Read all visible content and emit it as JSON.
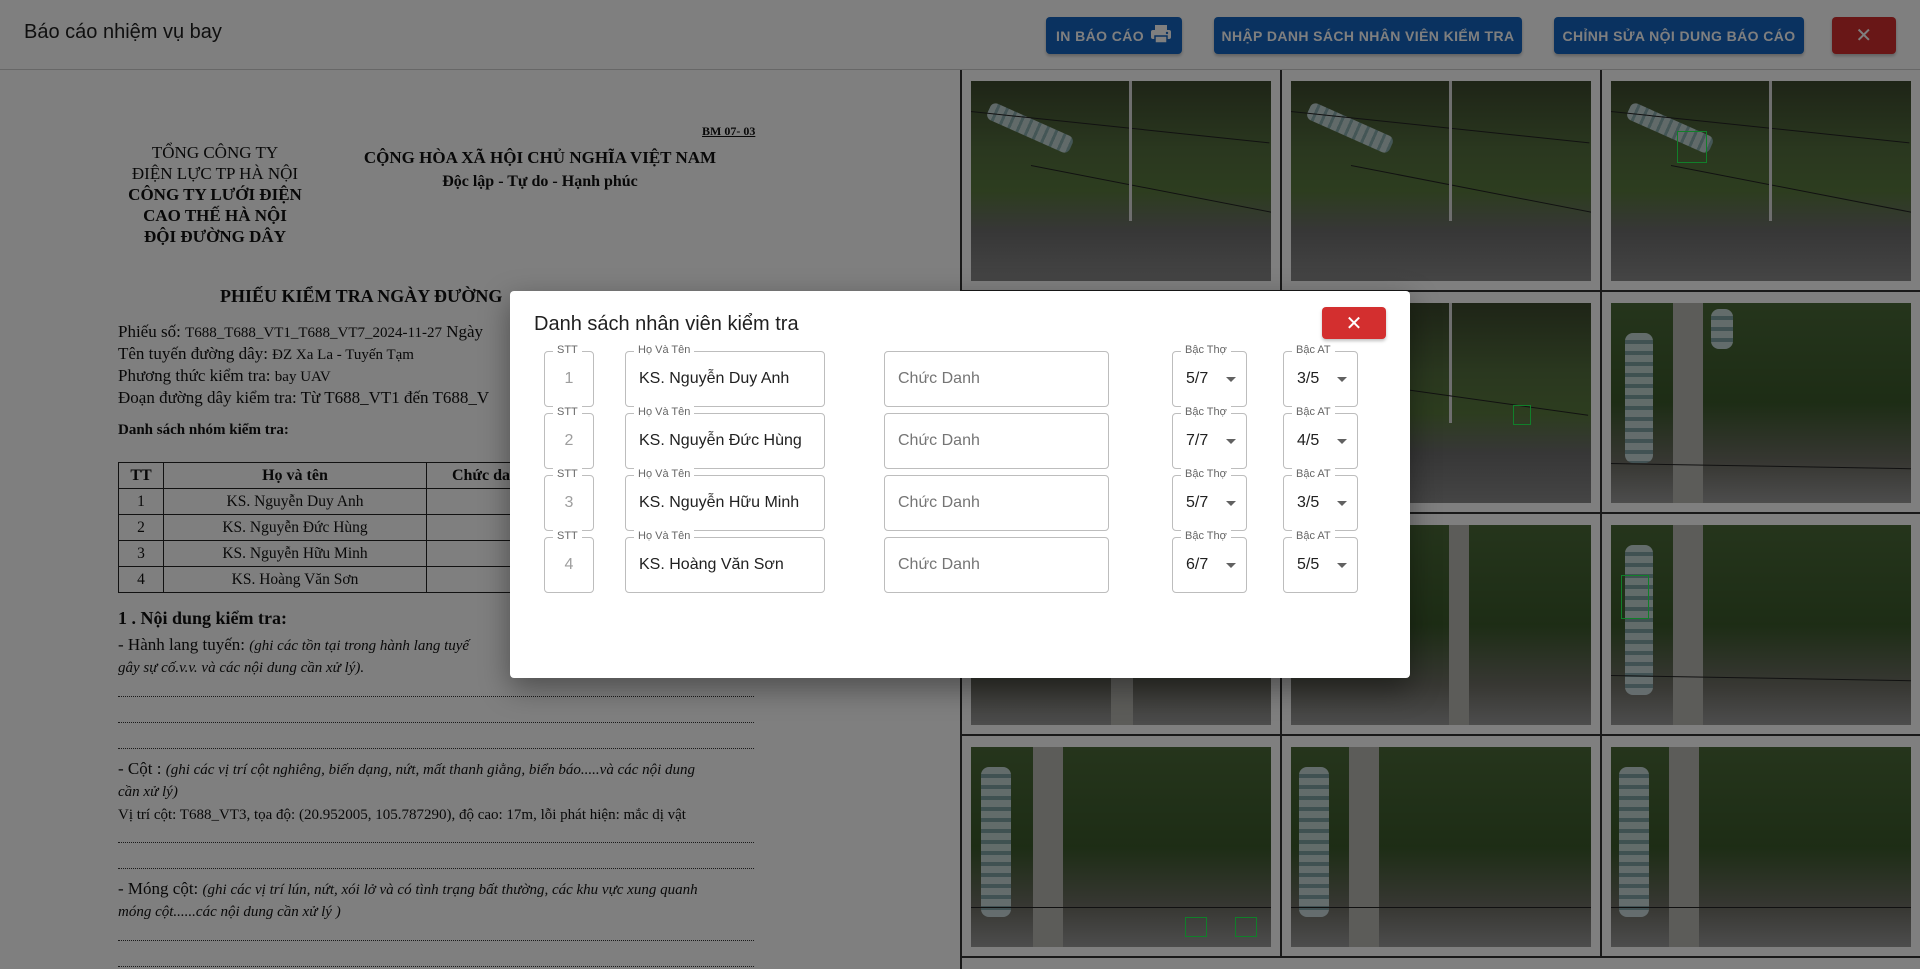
{
  "header": {
    "title": "Báo cáo nhiệm vụ bay",
    "print_label": "IN BÁO CÁO",
    "import_label": "NHẬP DANH SÁCH NHÂN VIÊN KIỂM TRA",
    "edit_label": "CHỈNH SỬA NỘI DUNG BÁO CÁO",
    "close_symbol": "✕",
    "colors": {
      "primary": "#1565c0",
      "danger": "#d32f2f"
    }
  },
  "document": {
    "org": {
      "line1": "TỔNG CÔNG TY",
      "line2": "ĐIỆN LỰC TP HÀ NỘI",
      "line3": "CÔNG TY LƯỚI ĐIỆN",
      "line4": "CAO THẾ HÀ NỘI",
      "line5": "ĐỘI ĐƯỜNG DÂY"
    },
    "form_code": "BM 07- 03",
    "nation": "CỘNG HÒA XÃ HỘI CHỦ NGHĨA VIỆT NAM",
    "motto": "Độc lập - Tự do - Hạnh phúc",
    "title": "PHIẾU KIỂM TRA NGÀY ĐƯỜNG",
    "ticket_label": "Phiếu số:",
    "ticket_value": "T688_T688_VT1_T688_VT7_2024-11-27",
    "ticket_suffix": "Ngày",
    "route_label": "Tên tuyến đường dây:",
    "route_value": "ĐZ Xa La - Tuyến Tạm",
    "method_label": "Phương thức kiểm tra:",
    "method_value": "bay UAV",
    "segment_label": "Đoạn đường dây kiểm tra:",
    "segment_value": "Từ T688_VT1 đến T688_V",
    "group_title": "Danh sách nhóm kiểm tra:",
    "table_headers": [
      "TT",
      "Họ và tên",
      "Chức da"
    ],
    "table_rows": [
      [
        "1",
        "KS. Nguyễn Duy Anh",
        ""
      ],
      [
        "2",
        "KS. Nguyễn Đức Hùng",
        ""
      ],
      [
        "3",
        "KS. Nguyễn Hữu Minh",
        ""
      ],
      [
        "4",
        "KS. Hoàng Văn Sơn",
        ""
      ]
    ],
    "section1_title": "1 . Nội dung kiểm tra:",
    "corridor_label": "- Hành lang tuyến:",
    "corridor_note": "(ghi các tồn tại trong hành lang tuyế",
    "corridor_note2": "gây sự cố.v.v. và các nội dung cần xử lý).",
    "pole_label": "- Cột :",
    "pole_note": "(ghi các vị trí cột nghiêng, biến dạng, nứt, mất thanh giằng, biển báo.....và các nội dung",
    "pole_note2": "cần xử lý)",
    "pole_detail": "Vị trí cột: T688_VT3, tọa độ: (20.952005, 105.787290), độ cao: 17m, lỗi phát hiện: mắc dị vật",
    "foundation_label": "- Móng cột:",
    "foundation_note": "(ghi các vị trí lún, nứt, xói lở và có tình trạng bất thường, các khu vực xung quanh",
    "foundation_note2": "móng cột......các nội dung cần xử lý )"
  },
  "modal": {
    "title": "Danh sách nhân viên kiểm tra",
    "close_symbol": "✕",
    "labels": {
      "stt": "STT",
      "name": "Họ Và Tên",
      "position_placeholder": "Chức Danh",
      "worker_grade": "Bậc Thợ",
      "safety_grade": "Bậc AT"
    },
    "rows": [
      {
        "stt": "1",
        "name": "KS. Nguyễn Duy Anh",
        "worker_grade": "5/7",
        "safety_grade": "3/5"
      },
      {
        "stt": "2",
        "name": "KS. Nguyễn Đức Hùng",
        "worker_grade": "7/7",
        "safety_grade": "4/5"
      },
      {
        "stt": "3",
        "name": "KS. Nguyễn Hữu Minh",
        "worker_grade": "5/7",
        "safety_grade": "3/5"
      },
      {
        "stt": "4",
        "name": "KS. Hoàng Văn Sơn",
        "worker_grade": "6/7",
        "safety_grade": "5/5"
      }
    ]
  },
  "gallery": {
    "photos": [
      "insulator-string-1",
      "insulator-string-2",
      "insulator-string-detected",
      "pole-view-1",
      "pole-view-2",
      "pole-view-detected",
      "pole-view-3",
      "pole-view-4",
      "pole-view-5",
      "pole-view-6",
      "pole-view-7",
      "pole-view-8"
    ]
  }
}
